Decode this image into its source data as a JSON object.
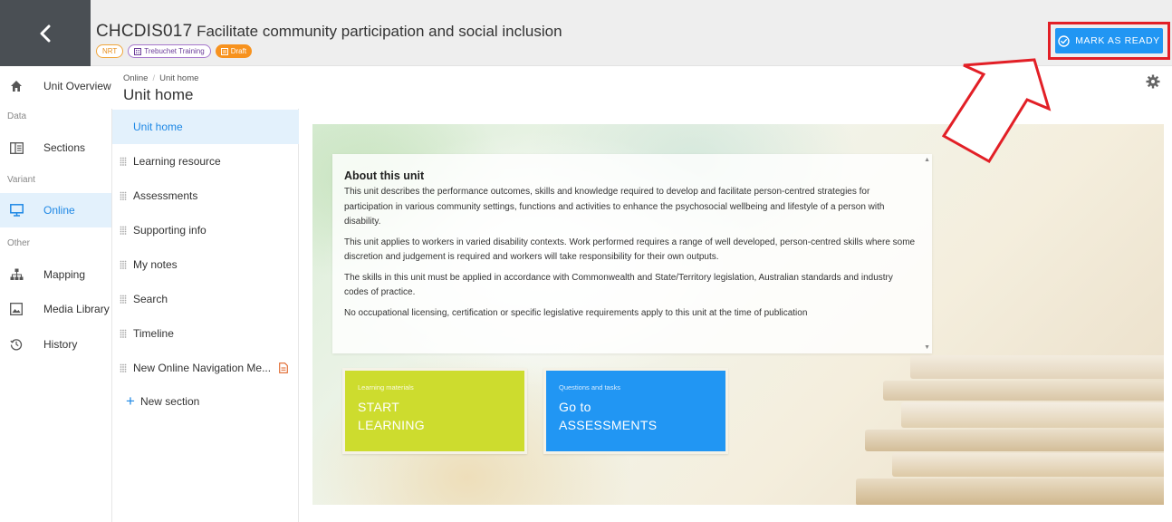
{
  "header": {
    "code": "CHCDIS017",
    "title": "Facilitate community participation and social inclusion",
    "badges": {
      "nrt": "NRT",
      "org": "Trebuchet Training",
      "draft": "Draft"
    },
    "mark_ready_label": "MARK AS READY"
  },
  "sidebar": {
    "items": [
      {
        "label": "Unit Overview",
        "icon": "home-icon"
      },
      {
        "category": "Data"
      },
      {
        "label": "Sections",
        "icon": "sections-icon"
      },
      {
        "category": "Variant"
      },
      {
        "label": "Online",
        "icon": "monitor-icon",
        "active": true
      },
      {
        "category": "Other"
      },
      {
        "label": "Mapping",
        "icon": "sitemap-icon"
      },
      {
        "label": "Media Library",
        "icon": "image-icon"
      },
      {
        "label": "History",
        "icon": "history-icon"
      }
    ]
  },
  "breadcrumb": {
    "parent": "Online",
    "current": "Unit home"
  },
  "page_title": "Unit home",
  "sections": {
    "items": [
      {
        "label": "Unit home",
        "active": true
      },
      {
        "label": "Learning resource"
      },
      {
        "label": "Assessments"
      },
      {
        "label": "Supporting info"
      },
      {
        "label": "My notes"
      },
      {
        "label": "Search"
      },
      {
        "label": "Timeline"
      },
      {
        "label": "New Online Navigation Me...",
        "doc_icon": true
      }
    ],
    "new_section_label": "New section"
  },
  "about": {
    "title": "About this unit",
    "paragraphs": [
      "This unit describes the performance outcomes, skills and knowledge required to develop and facilitate person-centred strategies for participation in various community settings, functions and activities to enhance the psychosocial wellbeing and lifestyle of a person with disability.",
      "This unit applies to workers in varied disability contexts. Work performed requires a range of well developed, person-centred skills where some discretion and judgement is required and workers will take responsibility for their own outputs.",
      "The skills in this unit must be applied in accordance with Commonwealth and State/Territory legislation, Australian standards and industry codes of practice.",
      "No occupational licensing, certification or specific legislative requirements apply to this unit at the time of publication"
    ]
  },
  "tiles": {
    "learning": {
      "kicker": "Learning materials",
      "line1": "START",
      "line2": "LEARNING"
    },
    "assessments": {
      "kicker": "Questions and tasks",
      "line1": "Go to",
      "line2": "ASSESSMENTS"
    }
  },
  "colors": {
    "accent": "#2196f3",
    "learning_tile": "#cddc2e",
    "header_dark": "#4a4f54",
    "draft_badge": "#f7921e",
    "highlight": "#e21f26"
  }
}
